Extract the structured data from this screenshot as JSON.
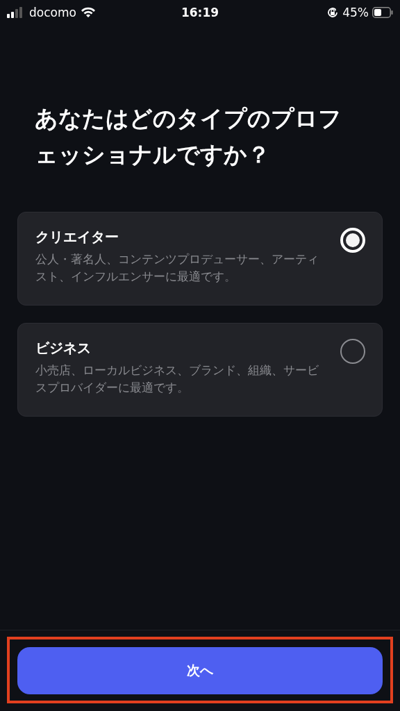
{
  "status_bar": {
    "carrier": "docomo",
    "time": "16:19",
    "battery": "45%"
  },
  "title": "あなたはどのタイプのプロフェッショナルですか？",
  "options": [
    {
      "label": "クリエイター",
      "description": "公人・著名人、コンテンツプロデューサー、アーティスト、インフルエンサーに最適です。",
      "selected": true
    },
    {
      "label": "ビジネス",
      "description": "小売店、ローカルビジネス、ブランド、組織、サービスプロバイダーに最適です。",
      "selected": false
    }
  ],
  "next_button": {
    "label": "次へ",
    "highlighted": true
  }
}
